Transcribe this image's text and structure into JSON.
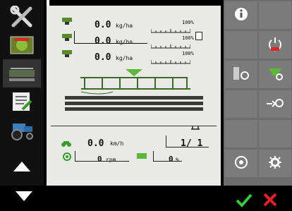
{
  "rows": [
    {
      "value": "0.0",
      "unit": "kg/ha",
      "pct": "100%"
    },
    {
      "value": "0.0",
      "unit": "kg/ha",
      "pct": "100%"
    },
    {
      "value": "0.0",
      "unit": "kg/ha",
      "pct": "100%"
    }
  ],
  "status": {
    "speed_value": "0.0",
    "speed_unit": "km/h",
    "section_value": "1/ 1",
    "rpm_value": "0",
    "rpm_unit": "rpm",
    "percent_value": "0",
    "percent_unit": "%"
  },
  "colors": {
    "accent_green": "#39c640",
    "cancel_red": "#e0222a",
    "panel_bg": "#e9e9e6",
    "button_grey": "#7b7b7b"
  },
  "icons": {
    "left": [
      "tools-icon",
      "map-icon",
      "machine-icon",
      "notepad-icon",
      "tractor-icon",
      "arrow-up-icon",
      "arrow-down-icon"
    ],
    "right": [
      "info-icon",
      "power-icon",
      "section-control-icon",
      "seed-hopper-icon",
      "transfer-icon",
      "wheel-icon",
      "settings-icon"
    ],
    "bottom": [
      "check-icon",
      "cancel-icon"
    ]
  }
}
